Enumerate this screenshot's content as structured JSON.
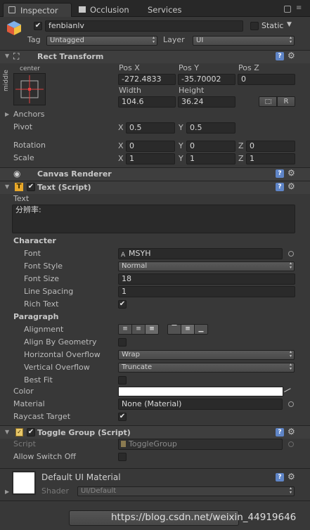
{
  "tabs": {
    "inspector": "Inspector",
    "occlusion": "Occlusion",
    "services": "Services"
  },
  "object": {
    "name": "fenbianlv",
    "static_label": "Static",
    "tag_label": "Tag",
    "tag_value": "Untagged",
    "layer_label": "Layer",
    "layer_value": "UI"
  },
  "rect_transform": {
    "title": "Rect Transform",
    "anchor_preset_h": "center",
    "anchor_preset_v": "middle",
    "posx_label": "Pos X",
    "posx": "-272.4833",
    "posy_label": "Pos Y",
    "posy": "-35.70002",
    "posz_label": "Pos Z",
    "posz": "0",
    "width_label": "Width",
    "width": "104.6",
    "height_label": "Height",
    "height": "36.24",
    "r_button": "R",
    "anchors_label": "Anchors",
    "pivot_label": "Pivot",
    "pivot_x": "0.5",
    "pivot_y": "0.5",
    "rotation_label": "Rotation",
    "rot_x": "0",
    "rot_y": "0",
    "rot_z": "0",
    "scale_label": "Scale",
    "scale_x": "1",
    "scale_y": "1",
    "scale_z": "1",
    "x": "X",
    "y": "Y",
    "z": "Z"
  },
  "canvas_renderer": {
    "title": "Canvas Renderer"
  },
  "text_script": {
    "title": "Text (Script)",
    "text_label": "Text",
    "text_value": "分辨率:",
    "character_label": "Character",
    "font_label": "Font",
    "font_value": "MSYH",
    "font_style_label": "Font Style",
    "font_style_value": "Normal",
    "font_size_label": "Font Size",
    "font_size_value": "18",
    "line_spacing_label": "Line Spacing",
    "line_spacing_value": "1",
    "rich_text_label": "Rich Text",
    "paragraph_label": "Paragraph",
    "alignment_label": "Alignment",
    "align_geom_label": "Align By Geometry",
    "h_overflow_label": "Horizontal Overflow",
    "h_overflow_value": "Wrap",
    "v_overflow_label": "Vertical Overflow",
    "v_overflow_value": "Truncate",
    "best_fit_label": "Best Fit",
    "color_label": "Color",
    "material_label": "Material",
    "material_value": "None (Material)",
    "raycast_label": "Raycast Target"
  },
  "toggle_group": {
    "title": "Toggle Group (Script)",
    "script_label": "Script",
    "script_value": "ToggleGroup",
    "allow_switch_off_label": "Allow Switch Off"
  },
  "material_section": {
    "title": "Default UI Material",
    "shader_label": "Shader",
    "shader_value": "UI/Default"
  },
  "watermark": "https://blog.csdn.net/weixin_44919646",
  "colors": {
    "background": "#383838",
    "header": "#3e3e3e",
    "field": "#2a2a2a",
    "color_swatch": "#ffffff",
    "help_icon": "#5f85c7"
  }
}
